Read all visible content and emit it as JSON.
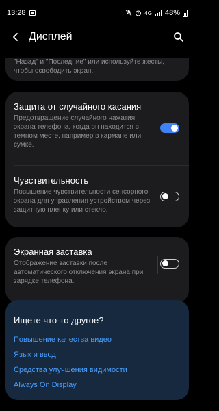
{
  "status_bar": {
    "time": "13:28",
    "battery": "48%",
    "network": "4G",
    "icons": [
      "image-icon",
      "mute-icon",
      "alarm-icon",
      "signal-icon",
      "battery-icon"
    ]
  },
  "header": {
    "title": "Дисплей",
    "back_icon": "arrow-left",
    "search_icon": "magnifier"
  },
  "top_snippet": "\"Назад\" и \"Последние\" или используйте жесты, чтобы освободить экран.",
  "settings": [
    {
      "title": "Защита от случайного касания",
      "desc": "Предотвращение случайного нажатия экрана телефона, когда он находится в темном месте, например в кармане или сумке.",
      "enabled": true
    },
    {
      "title": "Чувствительность",
      "desc": "Повышение чувствительности сенсорного экрана для управления устройством через защитную пленку или стекло.",
      "enabled": false
    },
    {
      "title": "Экранная заставка",
      "desc": "Отображение заставки после автоматического отключения экрана при зарядке телефона.",
      "enabled": false
    }
  ],
  "suggestions": {
    "title": "Ищете что-то другое?",
    "links": [
      "Повышение качества видео",
      "Язык и ввод",
      "Средства улучшения видимости",
      "Always On Display"
    ]
  },
  "colors": {
    "background": "#000000",
    "card": "#1c1c1e",
    "suggest_card": "#16293f",
    "accent": "#3f82f4",
    "link": "#4a9fff",
    "secondary_text": "#8e8e93"
  }
}
